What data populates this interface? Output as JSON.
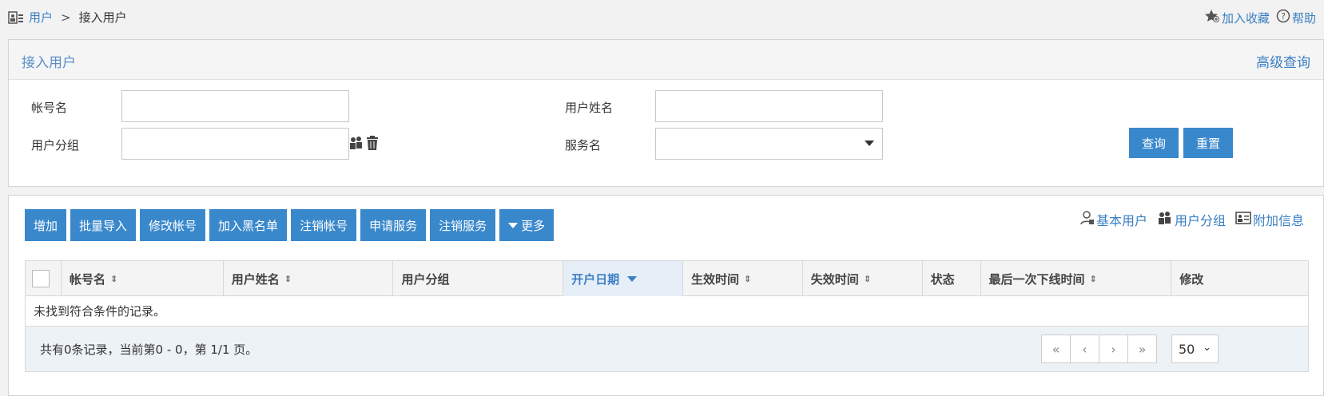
{
  "breadcrumb": {
    "root": "用户",
    "separator": ">",
    "current": "接入用户"
  },
  "top_links": {
    "favorite": "加入收藏",
    "help": "帮助"
  },
  "query": {
    "title": "接入用户",
    "advanced": "高级查询",
    "account_label": "帐号名",
    "account_value": "",
    "username_label": "用户姓名",
    "username_value": "",
    "group_label": "用户分组",
    "group_value": "",
    "service_label": "服务名",
    "service_value": "",
    "search_button": "查询",
    "reset_button": "重置"
  },
  "toolbar": {
    "buttons": [
      "增加",
      "批量导入",
      "修改帐号",
      "加入黑名单",
      "注销帐号",
      "申请服务",
      "注销服务"
    ],
    "more": "更多"
  },
  "view_links": {
    "basic": "基本用户",
    "group": "用户分组",
    "extra": "附加信息"
  },
  "table": {
    "columns": [
      "帐号名",
      "用户姓名",
      "用户分组",
      "开户日期",
      "生效时间",
      "失效时间",
      "状态",
      "最后一次下线时间",
      "修改"
    ],
    "empty": "未找到符合条件的记录。"
  },
  "footer": {
    "info": "共有0条记录，当前第0 - 0，第 1/1 页。",
    "page_size": "50"
  },
  "colors": {
    "accent": "#3a88cc",
    "link": "#3a7fc3"
  }
}
